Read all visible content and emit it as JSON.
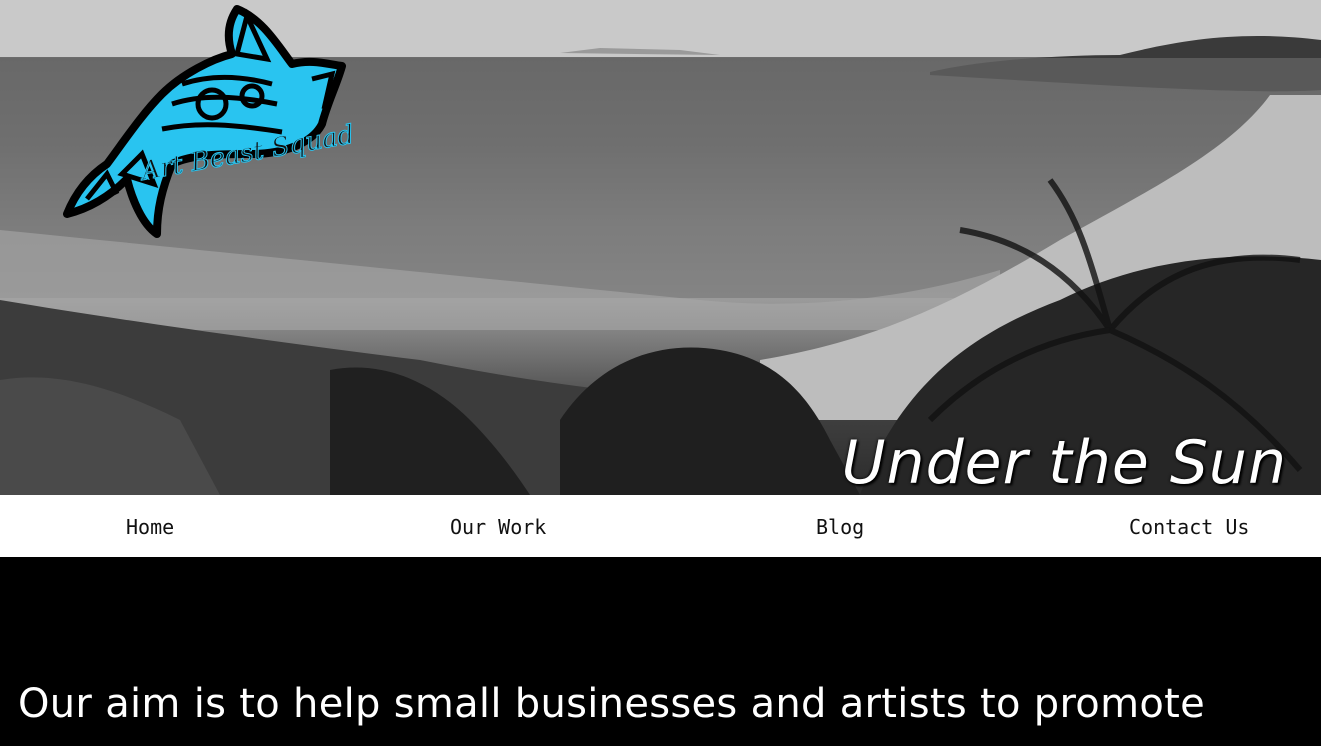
{
  "hero": {
    "title": "Under the Sun"
  },
  "logo": {
    "text": "Art Beast Squad",
    "accent_color": "#29c4f0"
  },
  "nav": {
    "items": [
      {
        "label": "Home"
      },
      {
        "label": "Our Work"
      },
      {
        "label": "Blog"
      },
      {
        "label": "Contact Us"
      }
    ]
  },
  "main": {
    "aim_text": "Our aim is to help small businesses and artists to promote"
  }
}
